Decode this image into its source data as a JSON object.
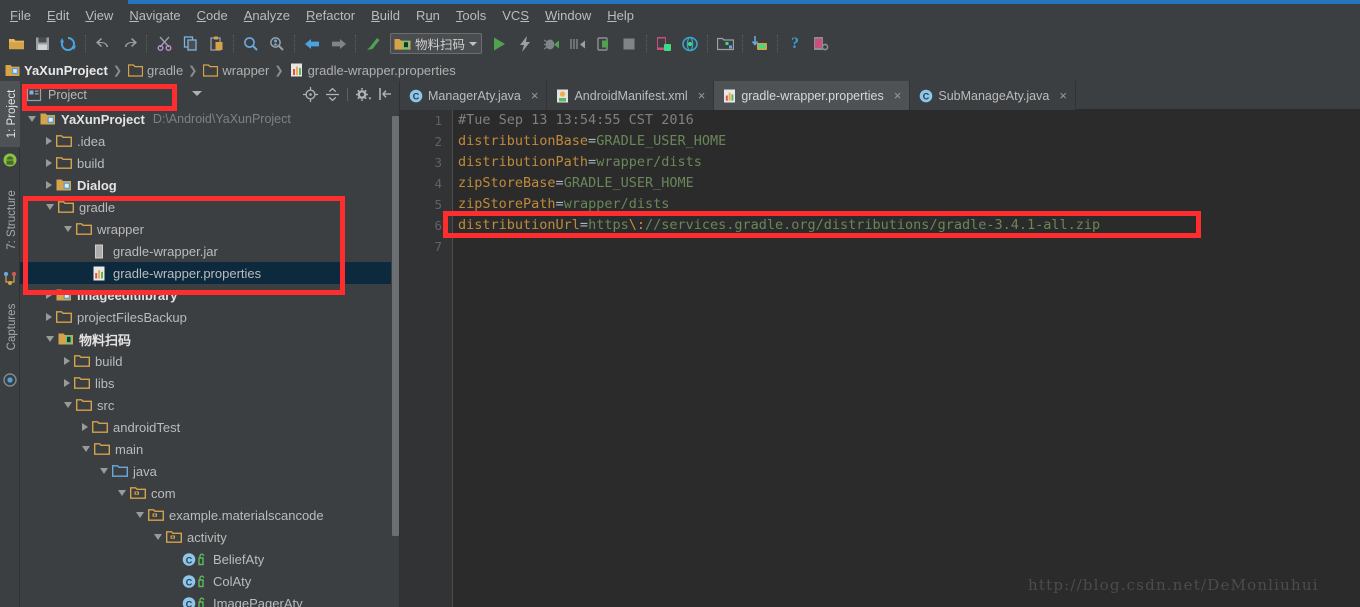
{
  "menu": {
    "items": [
      {
        "pre": "",
        "mn": "F",
        "post": "ile"
      },
      {
        "pre": "",
        "mn": "E",
        "post": "dit"
      },
      {
        "pre": "",
        "mn": "V",
        "post": "iew"
      },
      {
        "pre": "",
        "mn": "N",
        "post": "avigate"
      },
      {
        "pre": "",
        "mn": "C",
        "post": "ode"
      },
      {
        "pre": "",
        "mn": "A",
        "post": "nalyze"
      },
      {
        "pre": "",
        "mn": "R",
        "post": "efactor"
      },
      {
        "pre": "",
        "mn": "B",
        "post": "uild"
      },
      {
        "pre": "R",
        "mn": "u",
        "post": "n"
      },
      {
        "pre": "",
        "mn": "T",
        "post": "ools"
      },
      {
        "pre": "VC",
        "mn": "S",
        "post": ""
      },
      {
        "pre": "",
        "mn": "W",
        "post": "indow"
      },
      {
        "pre": "",
        "mn": "H",
        "post": "elp"
      }
    ]
  },
  "toolbar": {
    "icons": [
      "open-folder-icon",
      "save-all-icon",
      "sync-icon",
      "undo-icon",
      "redo-icon",
      "cut-icon",
      "copy-icon",
      "paste-icon",
      "find-icon",
      "find-structure-icon",
      "back-icon",
      "forward-icon",
      "make-project-icon"
    ],
    "run_config": "物料扫码",
    "run_icons": [
      "run-icon",
      "apply-changes-icon",
      "debug-icon",
      "step-icon",
      "attach-debugger-icon",
      "stop-icon"
    ],
    "right_icons": [
      "avd-manager-icon",
      "sdk-manager-icon",
      "project-structure-icon",
      "sync-gradle-icon",
      "help-icon",
      "device-manager-icon"
    ]
  },
  "breadcrumb": {
    "items": [
      {
        "label": "YaXunProject",
        "icon": "module-folder-icon",
        "root": true
      },
      {
        "label": "gradle",
        "icon": "folder-icon",
        "root": false
      },
      {
        "label": "wrapper",
        "icon": "folder-icon",
        "root": false
      },
      {
        "label": "gradle-wrapper.properties",
        "icon": "properties-file-icon",
        "root": false
      }
    ],
    "separator": "❯"
  },
  "left_strip": {
    "items": [
      {
        "label": "1: Project",
        "selected": true,
        "icon": "android-icon"
      },
      {
        "label": "7: Structure",
        "selected": false,
        "icon": "structure-icon"
      },
      {
        "label": "Captures",
        "selected": false,
        "icon": "captures-icon"
      }
    ]
  },
  "project_panel": {
    "title": "Project",
    "title_icon": "project-view-icon",
    "tools": [
      "locate-icon",
      "collapse-all-icon",
      "settings-gear-icon",
      "hide-panel-icon"
    ]
  },
  "tree": [
    {
      "depth": 0,
      "arrow": "open",
      "icon": "module-folder-icon",
      "label": "YaXunProject",
      "bold": true,
      "path": "D:\\Android\\YaXunProject",
      "selected": false
    },
    {
      "depth": 1,
      "arrow": "closed",
      "icon": "folder-icon",
      "label": ".idea",
      "bold": false,
      "path": "",
      "selected": false
    },
    {
      "depth": 1,
      "arrow": "closed",
      "icon": "folder-icon",
      "label": "build",
      "bold": false,
      "path": "",
      "selected": false
    },
    {
      "depth": 1,
      "arrow": "closed",
      "icon": "module-folder-icon",
      "label": "Dialog",
      "bold": true,
      "path": "",
      "selected": false
    },
    {
      "depth": 1,
      "arrow": "open",
      "icon": "folder-icon",
      "label": "gradle",
      "bold": false,
      "path": "",
      "selected": false
    },
    {
      "depth": 2,
      "arrow": "open",
      "icon": "folder-icon",
      "label": "wrapper",
      "bold": false,
      "path": "",
      "selected": false
    },
    {
      "depth": 3,
      "arrow": "none",
      "icon": "jar-file-icon",
      "label": "gradle-wrapper.jar",
      "bold": false,
      "path": "",
      "selected": false
    },
    {
      "depth": 3,
      "arrow": "none",
      "icon": "properties-file-icon",
      "label": "gradle-wrapper.properties",
      "bold": false,
      "path": "",
      "selected": true
    },
    {
      "depth": 1,
      "arrow": "closed",
      "icon": "module-folder-icon",
      "label": "imageeditlibrary",
      "bold": true,
      "path": "",
      "selected": false
    },
    {
      "depth": 1,
      "arrow": "closed",
      "icon": "folder-icon",
      "label": "projectFilesBackup",
      "bold": false,
      "path": "",
      "selected": false
    },
    {
      "depth": 1,
      "arrow": "open",
      "icon": "android-module-icon",
      "label": "物料扫码",
      "bold": true,
      "path": "",
      "selected": false
    },
    {
      "depth": 2,
      "arrow": "closed",
      "icon": "folder-icon",
      "label": "build",
      "bold": false,
      "path": "",
      "selected": false
    },
    {
      "depth": 2,
      "arrow": "closed",
      "icon": "folder-icon",
      "label": "libs",
      "bold": false,
      "path": "",
      "selected": false
    },
    {
      "depth": 2,
      "arrow": "open",
      "icon": "folder-icon",
      "label": "src",
      "bold": false,
      "path": "",
      "selected": false
    },
    {
      "depth": 3,
      "arrow": "closed",
      "icon": "folder-icon",
      "label": "androidTest",
      "bold": false,
      "path": "",
      "selected": false
    },
    {
      "depth": 3,
      "arrow": "open",
      "icon": "folder-icon",
      "label": "main",
      "bold": false,
      "path": "",
      "selected": false
    },
    {
      "depth": 4,
      "arrow": "open",
      "icon": "source-folder-icon",
      "label": "java",
      "bold": false,
      "path": "",
      "selected": false
    },
    {
      "depth": 5,
      "arrow": "open",
      "icon": "package-icon",
      "label": "com",
      "bold": false,
      "path": "",
      "selected": false
    },
    {
      "depth": 6,
      "arrow": "open",
      "icon": "package-icon",
      "label": "example.materialscancode",
      "bold": false,
      "path": "",
      "selected": false
    },
    {
      "depth": 7,
      "arrow": "open",
      "icon": "package-icon",
      "label": "activity",
      "bold": false,
      "path": "",
      "selected": false
    },
    {
      "depth": 8,
      "arrow": "none",
      "icon": "java-class-icon",
      "label": "BeliefAty",
      "bold": false,
      "path": "",
      "selected": false
    },
    {
      "depth": 8,
      "arrow": "none",
      "icon": "java-class-icon",
      "label": "ColAty",
      "bold": false,
      "path": "",
      "selected": false
    },
    {
      "depth": 8,
      "arrow": "none",
      "icon": "java-class-icon",
      "label": "ImagePagerAty",
      "bold": false,
      "path": "",
      "selected": false
    }
  ],
  "editor": {
    "tabs": [
      {
        "label": "ManagerAty.java",
        "icon": "java-class-icon",
        "active": false,
        "close": "×"
      },
      {
        "label": "AndroidManifest.xml",
        "icon": "manifest-file-icon",
        "active": false,
        "close": "×"
      },
      {
        "label": "gradle-wrapper.properties",
        "icon": "properties-file-icon",
        "active": true,
        "close": "×"
      },
      {
        "label": "SubManageAty.java",
        "icon": "java-class-icon",
        "active": false,
        "close": "×"
      }
    ],
    "line_numbers": [
      "1",
      "2",
      "3",
      "4",
      "5",
      "6",
      "7"
    ],
    "lines": [
      {
        "comment": "#Tue Sep 13 13:54:55 CST 2016"
      },
      {
        "key": "distributionBase",
        "eq": "=",
        "value": "GRADLE_USER_HOME"
      },
      {
        "key": "distributionPath",
        "eq": "=",
        "value": "wrapper/dists"
      },
      {
        "key": "zipStoreBase",
        "eq": "=",
        "value": "GRADLE_USER_HOME"
      },
      {
        "key": "zipStorePath",
        "eq": "=",
        "value": "wrapper/dists"
      },
      {
        "key": "distributionUrl",
        "eq": "=",
        "value_pre": "https",
        "escape": "\\:",
        "value_post": "//services.gradle.org/distributions/gradle-3.4.1-all.zip"
      },
      {
        "blank": ""
      }
    ]
  },
  "watermark": "http://blog.csdn.net/DeMonliuhui",
  "colors": {
    "accent_red": "#ff2d2d",
    "selection": "#0d293e",
    "editor_bg": "#2b2b2b",
    "chrome_bg": "#3c3f41",
    "key": "#bf8a3d",
    "value": "#6a8759",
    "comment": "#808080"
  }
}
